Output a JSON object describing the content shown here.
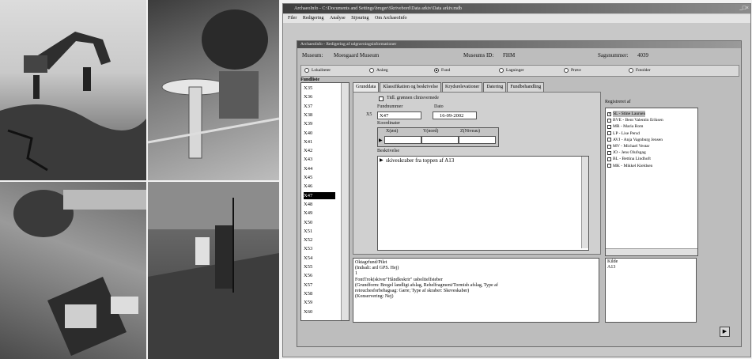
{
  "window": {
    "title": "ArchaeoInfo - C:\\Documents and Settings\\bruger\\Skrivebord\\Data arkiv\\Data arkiv.mdb",
    "controls": "_□×"
  },
  "menu": [
    "Filer",
    "Redigering",
    "Analyse",
    "Sijouring",
    "Om ArchaeoInfo"
  ],
  "form": {
    "title": "ArchaeoInfo - Redigering af udgravningsinformationer",
    "museum_label": "Museum:",
    "museum_value": "Moesgaard Museum",
    "museumsid_label": "Museums ID:",
    "museumsid_value": "FHM",
    "sagsnummer_label": "Sagsnummer:",
    "sagsnummer_value": "4039",
    "types": [
      {
        "label": "Lokaliteter",
        "on": false
      },
      {
        "label": "Anlæg",
        "on": false
      },
      {
        "label": "Fund",
        "on": true
      },
      {
        "label": "Lagninger",
        "on": false
      },
      {
        "label": "Prøve",
        "on": false
      },
      {
        "label": "Fotolder",
        "on": false
      }
    ],
    "fundliste_label": "Fundliste",
    "fundliste": [
      "X35",
      "X36",
      "X37",
      "X38",
      "X39",
      "X40",
      "X41",
      "X42",
      "X43",
      "X44",
      "X45",
      "X46",
      "X47",
      "X48",
      "X49",
      "X50",
      "X51",
      "X52",
      "X53",
      "X54",
      "X55",
      "X56",
      "X57",
      "X58",
      "X59",
      "X60"
    ],
    "selected": "X47",
    "tabs": [
      "Grunddata",
      "Klassifikation og beskrivelse",
      "Krydsrelevationer",
      "Datering",
      "Fundbehandling"
    ],
    "tidl_label": "Tidl. grønnen clinisvernede",
    "fundnummer_label": "Fundnummer",
    "fundnummer_value": "X47",
    "dato_label": "Dato",
    "dato_value": "16-09-2002",
    "row_marker": "X5",
    "koordinater_label": "Koordinater",
    "x_label": "X(øst)",
    "y_label": "Y(nord)",
    "z_label": "Z(Niveau)",
    "beskrivelse_label": "Beskrivelse",
    "beskrivelse_value": "skiveskraber fra toppen af A13",
    "registreret_label": "Registreret af",
    "registreret": [
      {
        "label": "SL - Stine Laursen",
        "checked": true
      },
      {
        "label": "BVE - Bent Valentin Eriksen",
        "checked": false
      },
      {
        "label": "MR - Maria Rom",
        "checked": false
      },
      {
        "label": "LP - Lise Persd",
        "checked": false
      },
      {
        "label": "AVJ - Anja Vagnburg Jensen",
        "checked": false
      },
      {
        "label": "MV - Michael Vestar",
        "checked": false
      },
      {
        "label": "JO - Jens Olufsgag",
        "checked": false
      },
      {
        "label": "BL - Bettina Lindhoft",
        "checked": false
      },
      {
        "label": "MK - Mikkel Kieldsen",
        "checked": false
      }
    ],
    "bottom_lines": [
      "Oktagrfund/Pilet",
      "(Indsalt: ard GPS. Hej)",
      "1",
      "FontTrok(skiver\"Håndleskrir\" usbolitelfsteber",
      "(Grundform: Bregel landligt afslag, Rehelfragment/Tormisb afslag, Type af",
      "retouchesforbehagsag: Gære; Type af skraber: Skeveskaber)",
      "(Konservering: Nej)"
    ],
    "kilde_label": "Kilde",
    "kilde_value": "A13",
    "nav": "▶"
  }
}
